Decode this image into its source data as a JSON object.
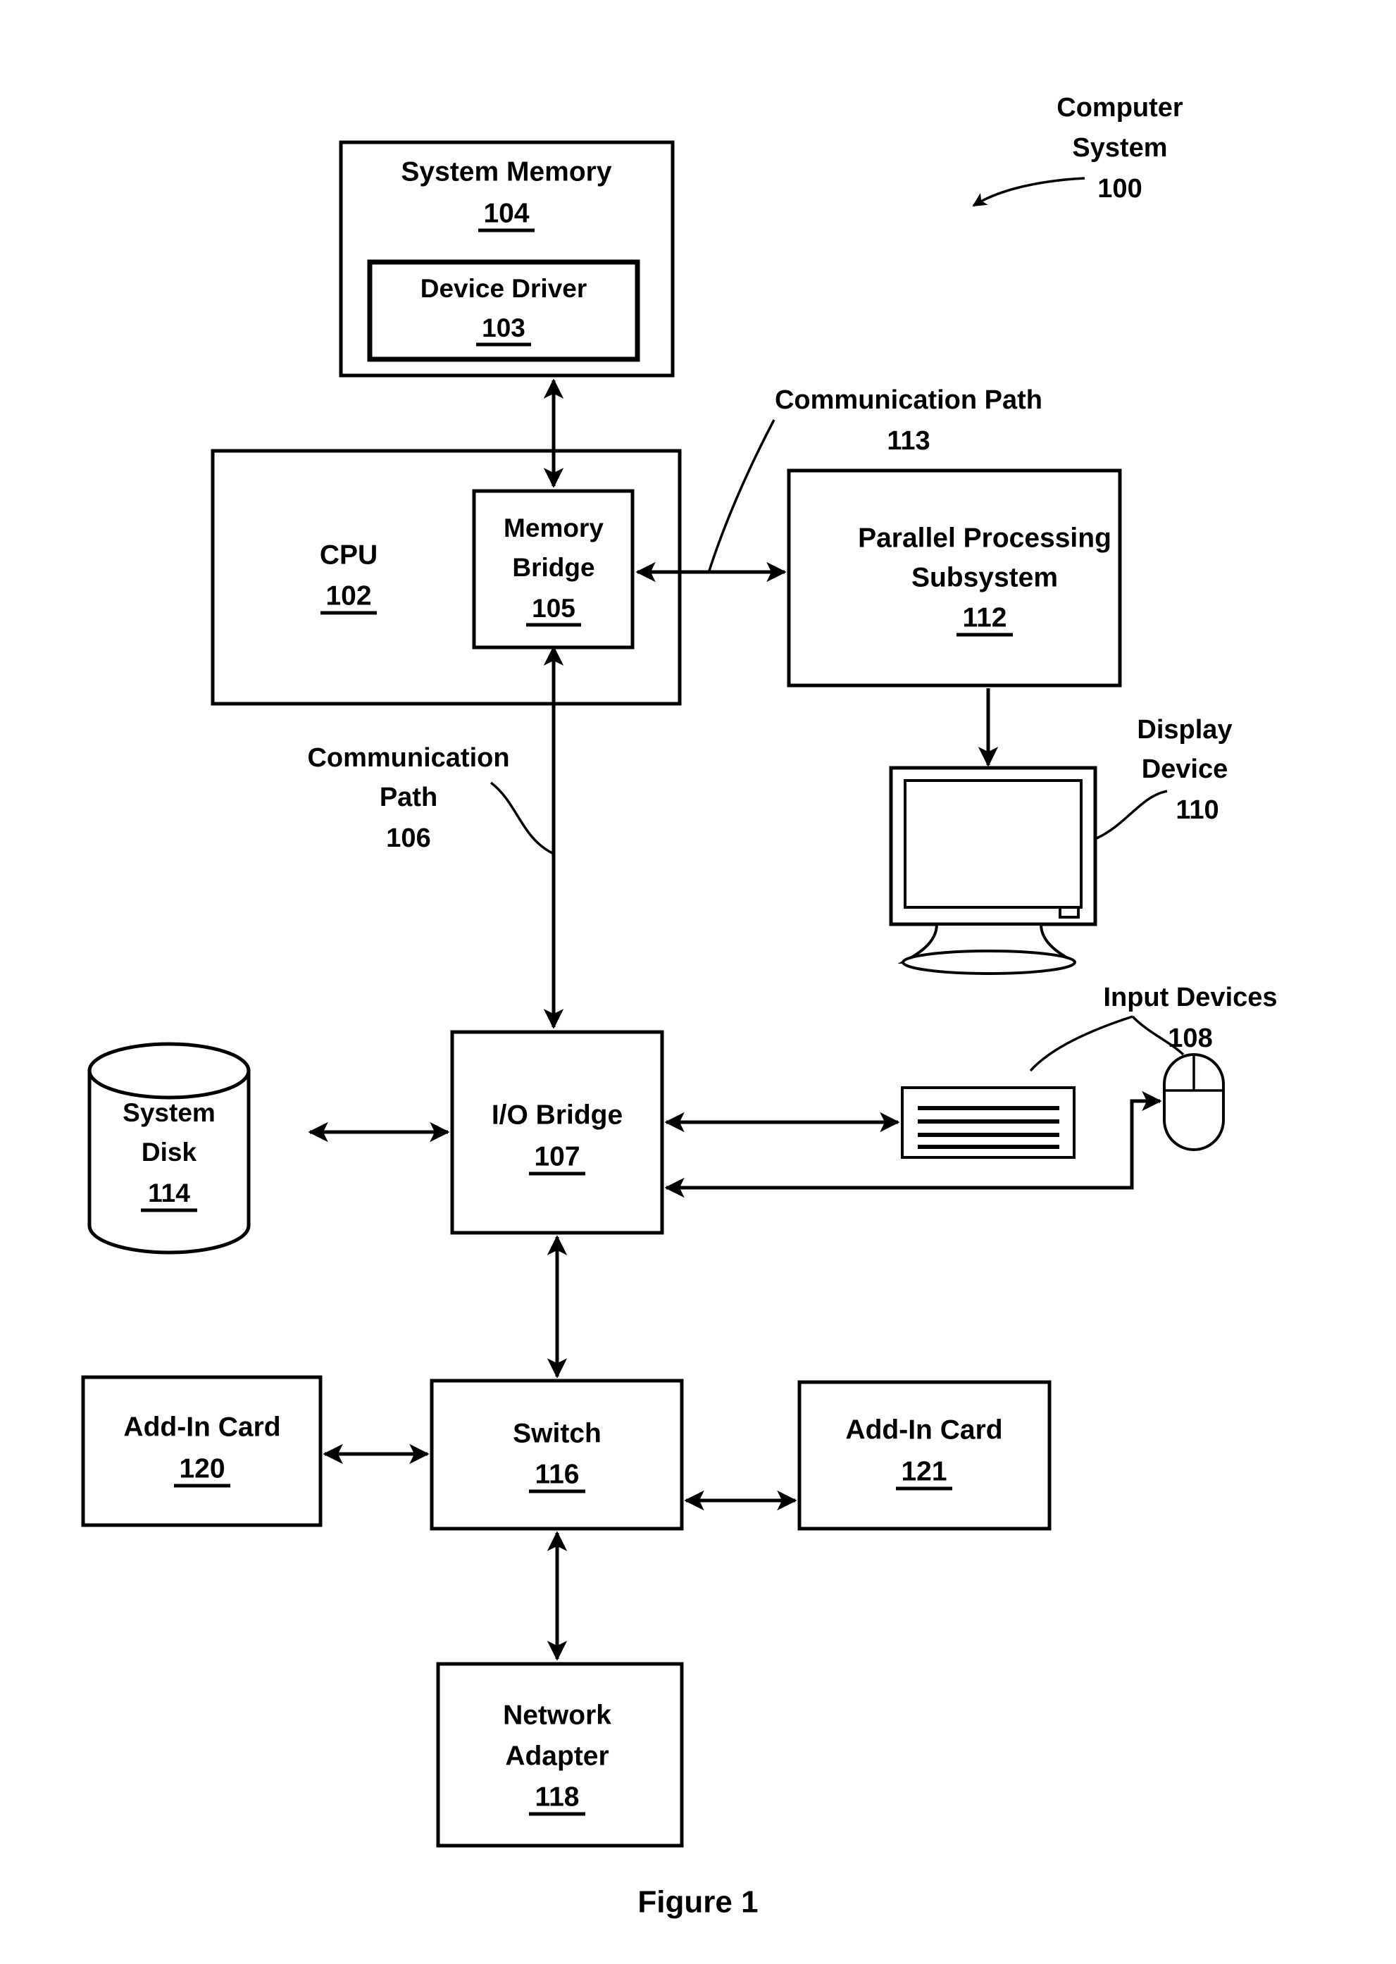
{
  "figure": {
    "caption": "Figure 1",
    "title_callout": {
      "line1": "Computer",
      "line2": "System",
      "ref": "100"
    }
  },
  "blocks": {
    "system_memory": {
      "label": "System Memory",
      "ref": "104"
    },
    "device_driver": {
      "label": "Device Driver",
      "ref": "103"
    },
    "cpu": {
      "label": "CPU",
      "ref": "102"
    },
    "memory_bridge": {
      "label_line1": "Memory",
      "label_line2": "Bridge",
      "ref": "105"
    },
    "parallel_processing_subsystem": {
      "label_line1": "Parallel Processing",
      "label_line2": "Subsystem",
      "ref": "112"
    },
    "io_bridge": {
      "label": "I/O Bridge",
      "ref": "107"
    },
    "system_disk": {
      "label_line1": "System",
      "label_line2": "Disk",
      "ref": "114"
    },
    "switch": {
      "label": "Switch",
      "ref": "116"
    },
    "add_in_card_left": {
      "label": "Add-In Card",
      "ref": "120"
    },
    "add_in_card_right": {
      "label": "Add-In Card",
      "ref": "121"
    },
    "network_adapter": {
      "label_line1": "Network",
      "label_line2": "Adapter",
      "ref": "118"
    }
  },
  "callouts": {
    "communication_path_113": {
      "line1": "Communication Path",
      "ref": "113"
    },
    "communication_path_106": {
      "line1": "Communication",
      "line2": "Path",
      "ref": "106"
    },
    "display_device": {
      "line1": "Display",
      "line2": "Device",
      "ref": "110"
    },
    "input_devices": {
      "line1": "Input Devices",
      "ref": "108"
    }
  },
  "icons": {
    "display_device": "monitor-icon",
    "keyboard": "keyboard-icon",
    "mouse": "mouse-icon",
    "system_disk": "database-cylinder-icon"
  },
  "colors": {
    "ink": "#000000",
    "paper": "#ffffff"
  }
}
